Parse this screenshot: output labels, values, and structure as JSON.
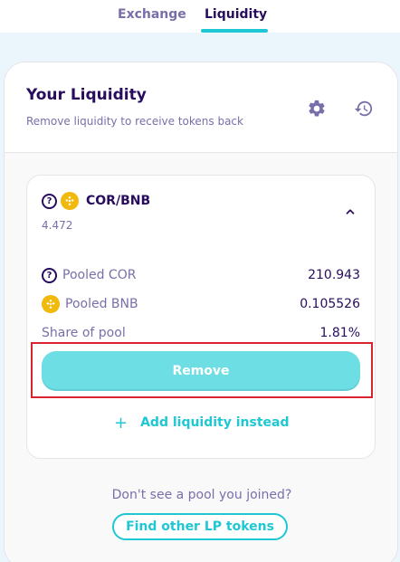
{
  "tabs": [
    {
      "label": "Exchange",
      "active": false
    },
    {
      "label": "Liquidity",
      "active": true
    }
  ],
  "header": {
    "title": "Your Liquidity",
    "subtitle": "Remove liquidity to receive tokens back",
    "icons": [
      "gear-icon",
      "history-icon"
    ]
  },
  "pool": {
    "pair": "COR/BNB",
    "lp_amount": "4.472",
    "rows": [
      {
        "label": "Pooled COR",
        "value": "210.943",
        "icon": "question-icon"
      },
      {
        "label": "Pooled BNB",
        "value": "0.105526",
        "icon": "bnb-icon"
      },
      {
        "label": "Share of pool",
        "value": "1.81%"
      }
    ],
    "remove_label": "Remove",
    "add_label": "Add liquidity instead"
  },
  "footer": {
    "no_pool_text": "Don't see a pool you joined?",
    "find_label": "Find other LP tokens"
  },
  "colors": {
    "primary": "#1fc7d4",
    "text": "#280d5f",
    "muted": "#7a6eaa",
    "highlight": "#d9232e",
    "bnb": "#f0b90b"
  }
}
